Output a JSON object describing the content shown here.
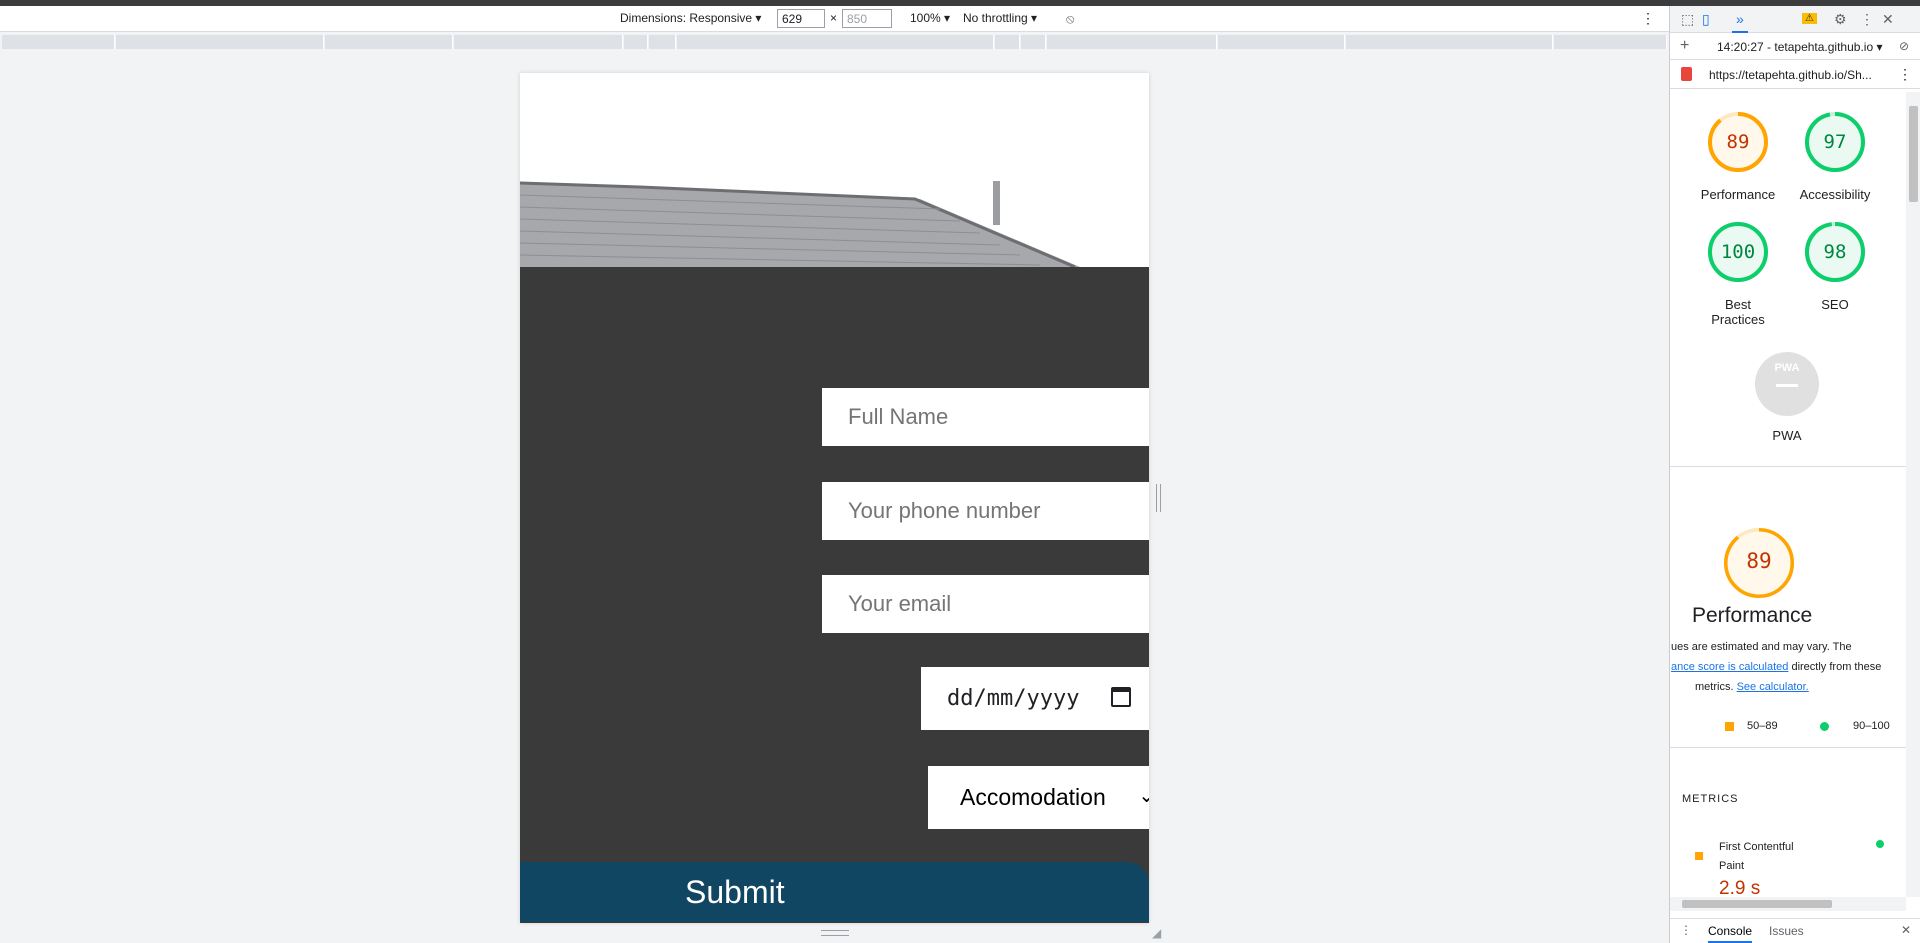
{
  "device_toolbar": {
    "dimensions_label": "Dimensions: Responsive",
    "width": "629",
    "height": "850",
    "times": "×",
    "zoom": "100%",
    "throttling": "No throttling"
  },
  "page": {
    "fields": {
      "full_name_placeholder": "Full Name",
      "phone_placeholder": "Your phone number",
      "email_placeholder": "Your email",
      "date_placeholder": "dd/mm/yyyy",
      "select_value": "Accomodation"
    },
    "submit_label": "Submit",
    "colors": {
      "form_bg": "#3a3a3a",
      "submit_bg": "#114663"
    }
  },
  "devtools": {
    "session_time": "14:20:27 - tetapehta.github.io",
    "url": "https://tetapehta.github.io/Sh...",
    "scores": [
      {
        "value": "89",
        "label": "Performance",
        "color": "#ffa400"
      },
      {
        "value": "97",
        "label": "Accessibility",
        "color": "#0cce6b"
      },
      {
        "value": "100",
        "label": "Best Practices",
        "color": "#0cce6b"
      },
      {
        "value": "98",
        "label": "SEO",
        "color": "#0cce6b"
      }
    ],
    "pwa_label": "PWA",
    "pwa_badge": "PWA",
    "performance_big": {
      "value": "89",
      "label": "Performance"
    },
    "note_line1": "ues are estimated and may vary. The",
    "note_link1": "ance score is calculated",
    "note_line2_rest": " directly from these",
    "note_line3_pre": "metrics. ",
    "note_link2": "See calculator.",
    "legend_mid": "50–89",
    "legend_high": "90–100",
    "metrics_heading": "METRICS",
    "metric_fcp_label": "First Contentful Paint",
    "metric_fcp_value": "2.9 s",
    "drawer_console": "Console",
    "drawer_issues": "Issues"
  }
}
